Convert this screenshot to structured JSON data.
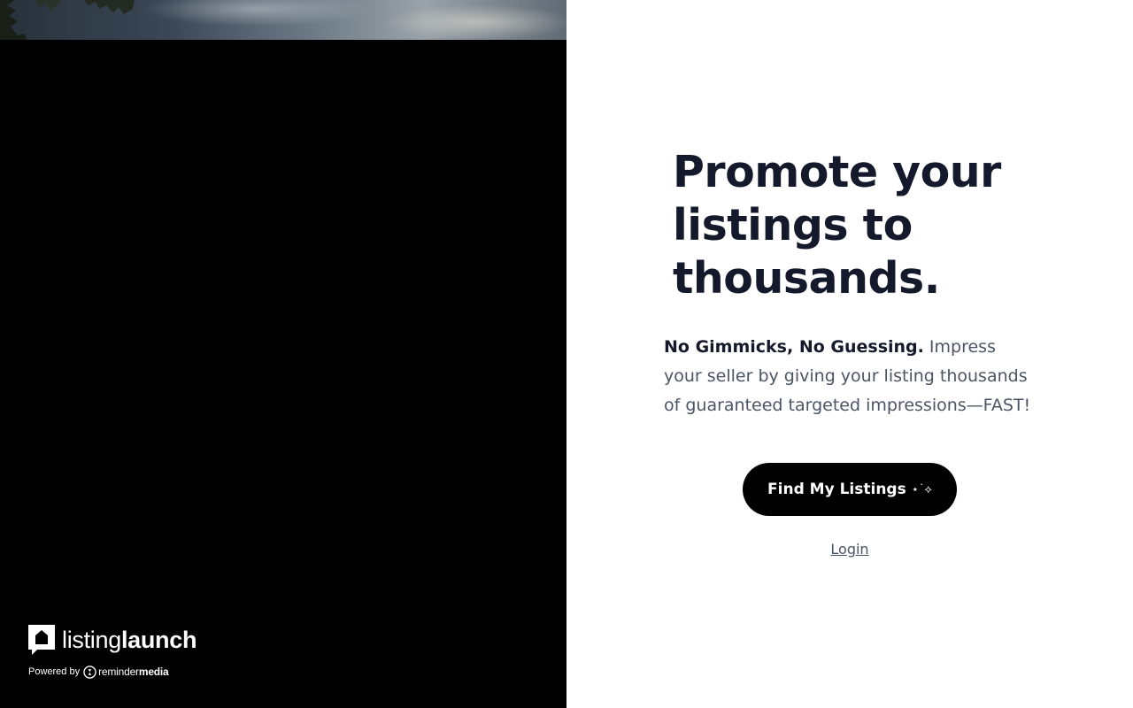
{
  "brand": {
    "name_light": "listing",
    "name_bold": "launch",
    "powered_by": "Powered by",
    "partner_light": "reminder",
    "partner_bold": "media"
  },
  "hero": {
    "headline": "Promote your listings to thousands.",
    "sub_strong": "No Gimmicks, No Guessing.",
    "sub_text": " Impress your seller by giving your listing thousands of guaranteed targeted impressions—FAST!"
  },
  "cta": {
    "label": "Find My Listings",
    "sparkle": "⋆˙⟡"
  },
  "login": {
    "label": "Login"
  },
  "colors": {
    "headline": "#141a2b",
    "body": "#4b5563",
    "button_bg": "#000000",
    "left_bg": "#000000"
  }
}
